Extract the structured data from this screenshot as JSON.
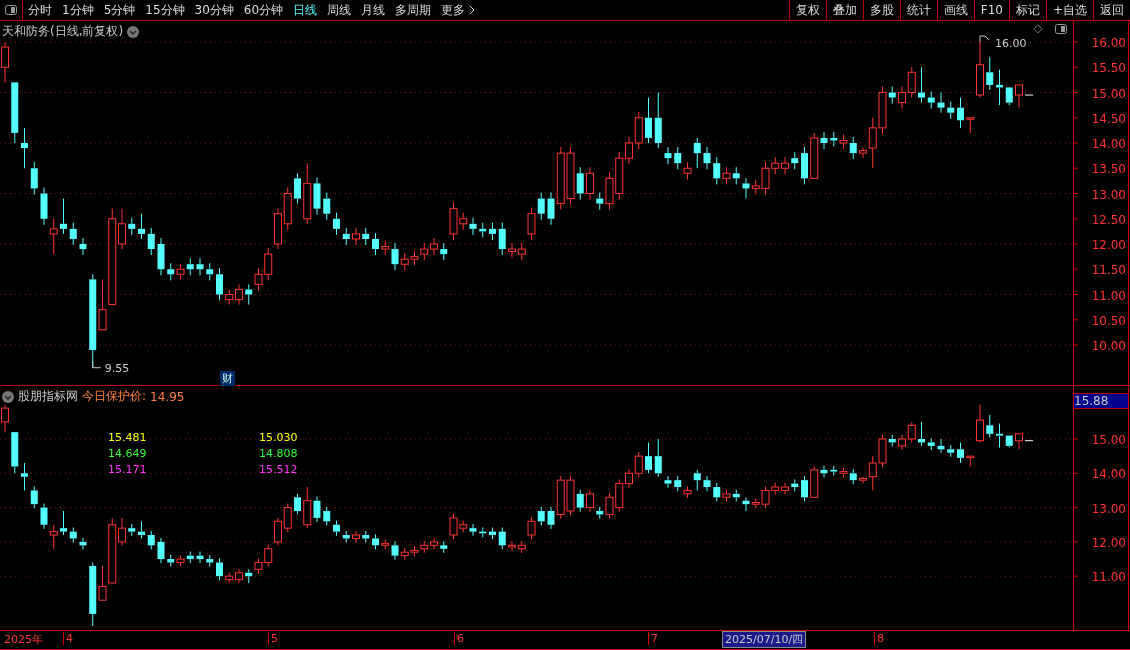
{
  "toolbar": {
    "periods": [
      {
        "label": "分时",
        "selected": false
      },
      {
        "label": "1分钟",
        "selected": false
      },
      {
        "label": "5分钟",
        "selected": false
      },
      {
        "label": "15分钟",
        "selected": false
      },
      {
        "label": "30分钟",
        "selected": false
      },
      {
        "label": "60分钟",
        "selected": false
      },
      {
        "label": "日线",
        "selected": true
      },
      {
        "label": "周线",
        "selected": false
      },
      {
        "label": "月线",
        "selected": false
      },
      {
        "label": "多周期",
        "selected": false
      }
    ],
    "more": "更多",
    "actions": [
      "复权",
      "叠加",
      "多股",
      "统计",
      "画线",
      "F10",
      "标记",
      "+自选",
      "返回"
    ]
  },
  "main_chart": {
    "title": "天和防务(日线,前复权)",
    "high_label": "16.00",
    "low_label": "9.55",
    "marker": "财",
    "y_axis": [
      "16.00",
      "15.50",
      "15.00",
      "14.50",
      "14.00",
      "13.50",
      "13.00",
      "12.50",
      "12.00",
      "11.50",
      "11.00",
      "10.50",
      "10.00"
    ]
  },
  "indicator": {
    "name": "股朋指标网",
    "protect_label": "今日保护价:",
    "protect_value": "14.95",
    "rows": [
      {
        "color": "#ffff00",
        "values": [
          "15.481",
          "15.030"
        ]
      },
      {
        "color": "#33ff33",
        "values": [
          "14.649",
          "14.808"
        ]
      },
      {
        "color": "#ff33ff",
        "values": [
          "15.171",
          "15.512"
        ]
      }
    ],
    "current_price": "15.88",
    "y_axis": [
      "15.00",
      "14.00",
      "13.00",
      "12.00",
      "11.00"
    ]
  },
  "time_axis": {
    "year": "2025年",
    "months": [
      "4",
      "5",
      "6",
      "7",
      "8"
    ],
    "cursor_date": "2025/07/10/四"
  }
}
